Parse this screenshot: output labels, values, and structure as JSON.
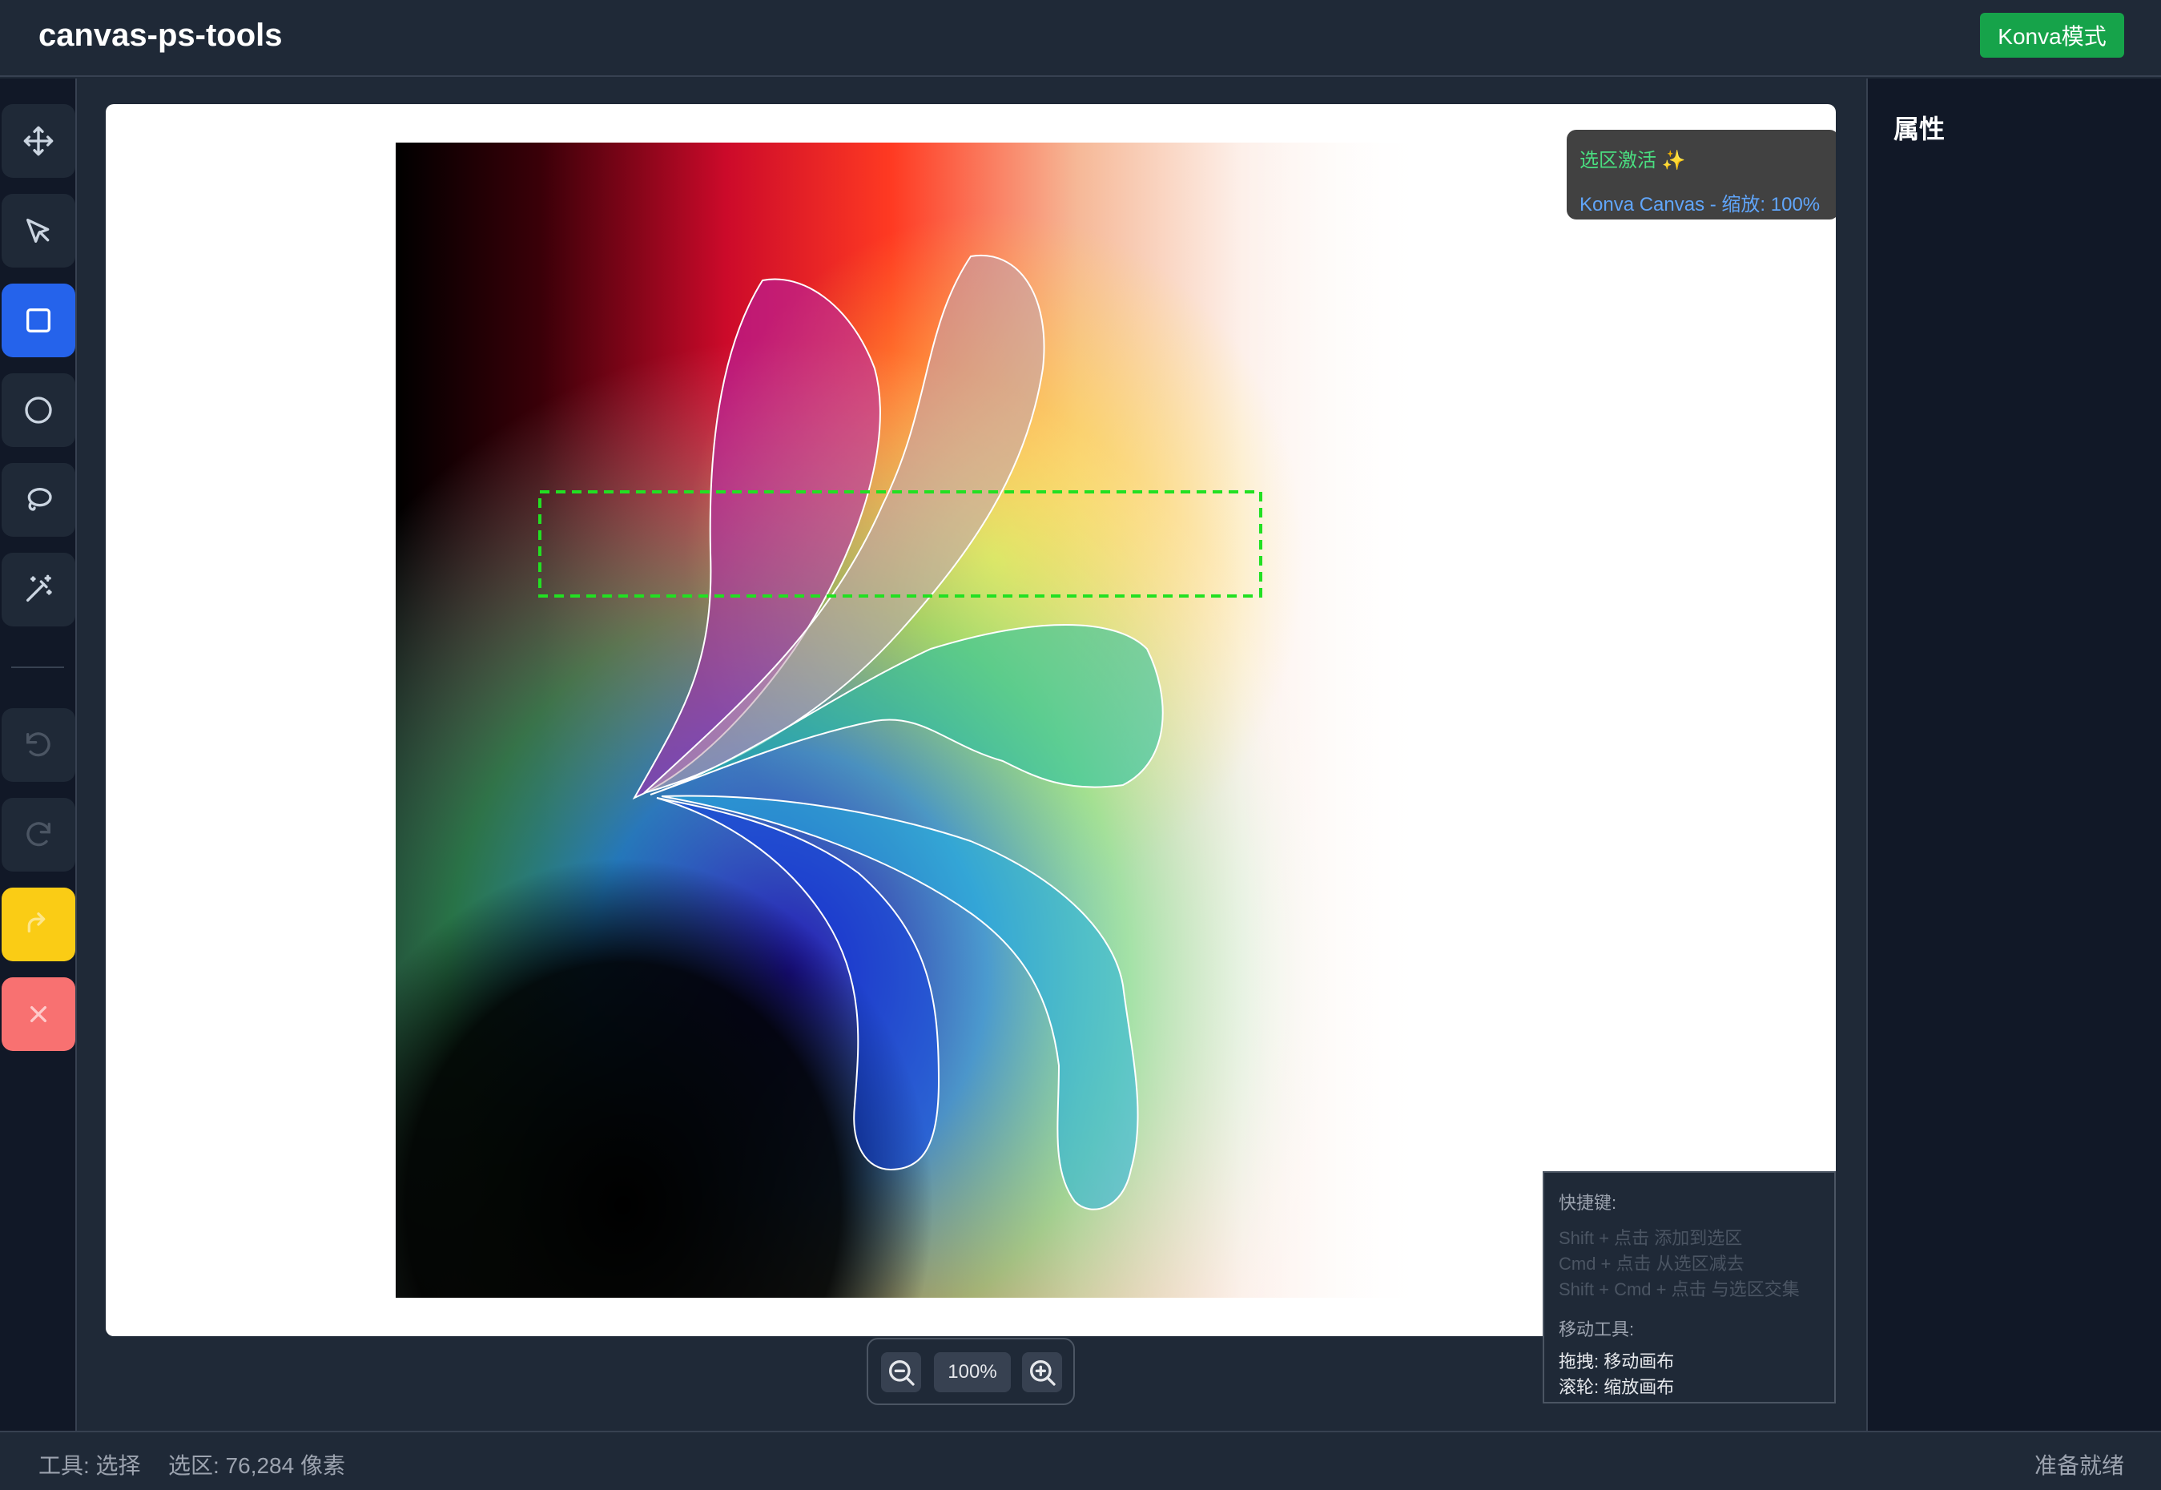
{
  "header": {
    "title": "canvas-ps-tools",
    "mode_button": "Konva模式"
  },
  "toolbar": {
    "tools": [
      {
        "name": "move",
        "icon": "move-icon",
        "active": false
      },
      {
        "name": "select",
        "icon": "cursor-arrow-icon",
        "active": false
      },
      {
        "name": "rectangle-select",
        "icon": "square-icon",
        "active": true
      },
      {
        "name": "ellipse-select",
        "icon": "circle-icon",
        "active": false
      },
      {
        "name": "lasso",
        "icon": "lasso-icon",
        "active": false
      },
      {
        "name": "magic-wand",
        "icon": "magic-wand-icon",
        "active": false
      }
    ],
    "history": [
      {
        "name": "undo",
        "icon": "undo-icon",
        "enabled": false
      },
      {
        "name": "redo",
        "icon": "redo-icon",
        "enabled": false
      },
      {
        "name": "export",
        "icon": "share-arrow-icon",
        "color": "#facc15"
      },
      {
        "name": "clear",
        "icon": "close-icon",
        "color": "#f87171"
      }
    ]
  },
  "canvas": {
    "overlay": {
      "selection_status": "选区激活 ✨",
      "info": "Konva Canvas - 缩放: 100%"
    },
    "selection_color": "#22c55e"
  },
  "shortcuts": {
    "title": "快捷键:",
    "items": [
      "Shift + 点击 添加到选区",
      "Cmd + 点击 从选区减去",
      "Shift + Cmd + 点击 与选区交集"
    ],
    "move_title": "移动工具:",
    "move_items": [
      "拖拽: 移动画布",
      "滚轮: 缩放画布"
    ]
  },
  "zoom": {
    "value": "100%"
  },
  "properties": {
    "title": "属性"
  },
  "statusbar": {
    "tool": "工具: 选择",
    "selection": "选区: 76,284 像素",
    "ready": "准备就绪"
  },
  "colors": {
    "accent": "#2563eb",
    "success": "#16a34a",
    "warning": "#facc15",
    "danger": "#f87171",
    "bg": "#1f2937",
    "panel": "#111827"
  }
}
